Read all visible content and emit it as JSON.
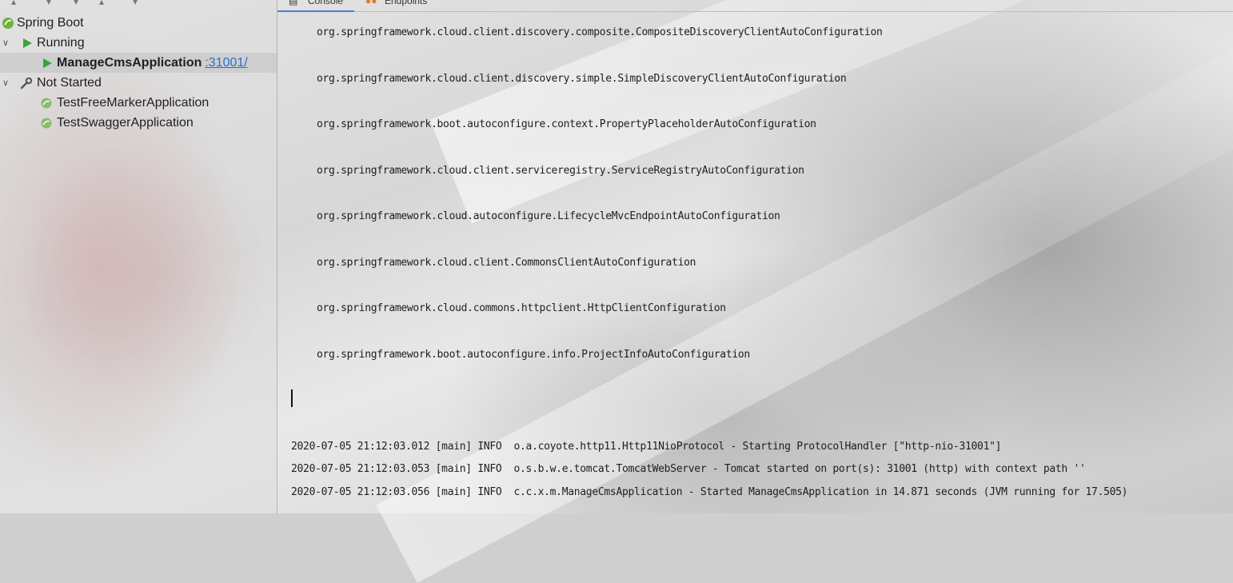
{
  "tool_window": {
    "tabs": [
      {
        "label": "Console"
      },
      {
        "label": "Endpoints"
      }
    ]
  },
  "tree": {
    "root": {
      "label": "Spring Boot",
      "icon": "spring-boot-icon"
    },
    "running": {
      "label": "Running",
      "icon": "run-icon"
    },
    "running_app": {
      "label": "ManageCmsApplication",
      "port": ":31001/",
      "icon": "run-icon"
    },
    "not_started": {
      "label": "Not Started",
      "icon": "wrench-icon"
    },
    "apps": [
      {
        "label": "TestFreeMarkerApplication",
        "icon": "spring-leaf-icon"
      },
      {
        "label": "TestSwaggerApplication",
        "icon": "spring-leaf-icon"
      }
    ]
  },
  "console": {
    "config_lines": [
      "org.springframework.cloud.client.discovery.composite.CompositeDiscoveryClientAutoConfiguration",
      "org.springframework.cloud.client.discovery.simple.SimpleDiscoveryClientAutoConfiguration",
      "org.springframework.boot.autoconfigure.context.PropertyPlaceholderAutoConfiguration",
      "org.springframework.cloud.client.serviceregistry.ServiceRegistryAutoConfiguration",
      "org.springframework.cloud.autoconfigure.LifecycleMvcEndpointAutoConfiguration",
      "org.springframework.cloud.client.CommonsClientAutoConfiguration",
      "org.springframework.cloud.commons.httpclient.HttpClientConfiguration",
      "org.springframework.boot.autoconfigure.info.ProjectInfoAutoConfiguration"
    ],
    "log_lines": [
      "2020-07-05 21:12:03.012 [main] INFO  o.a.coyote.http11.Http11NioProtocol - Starting ProtocolHandler [\"http-nio-31001\"]",
      "2020-07-05 21:12:03.053 [main] INFO  o.s.b.w.e.tomcat.TomcatWebServer - Tomcat started on port(s): 31001 (http) with context path ''",
      "2020-07-05 21:12:03.056 [main] INFO  c.c.x.m.ManageCmsApplication - Started ManageCmsApplication in 14.871 seconds (JVM running for 17.505)"
    ]
  },
  "colors": {
    "run_green": "#3aa53a",
    "link_blue": "#2b6fcf",
    "spring_green": "#6db33f"
  }
}
